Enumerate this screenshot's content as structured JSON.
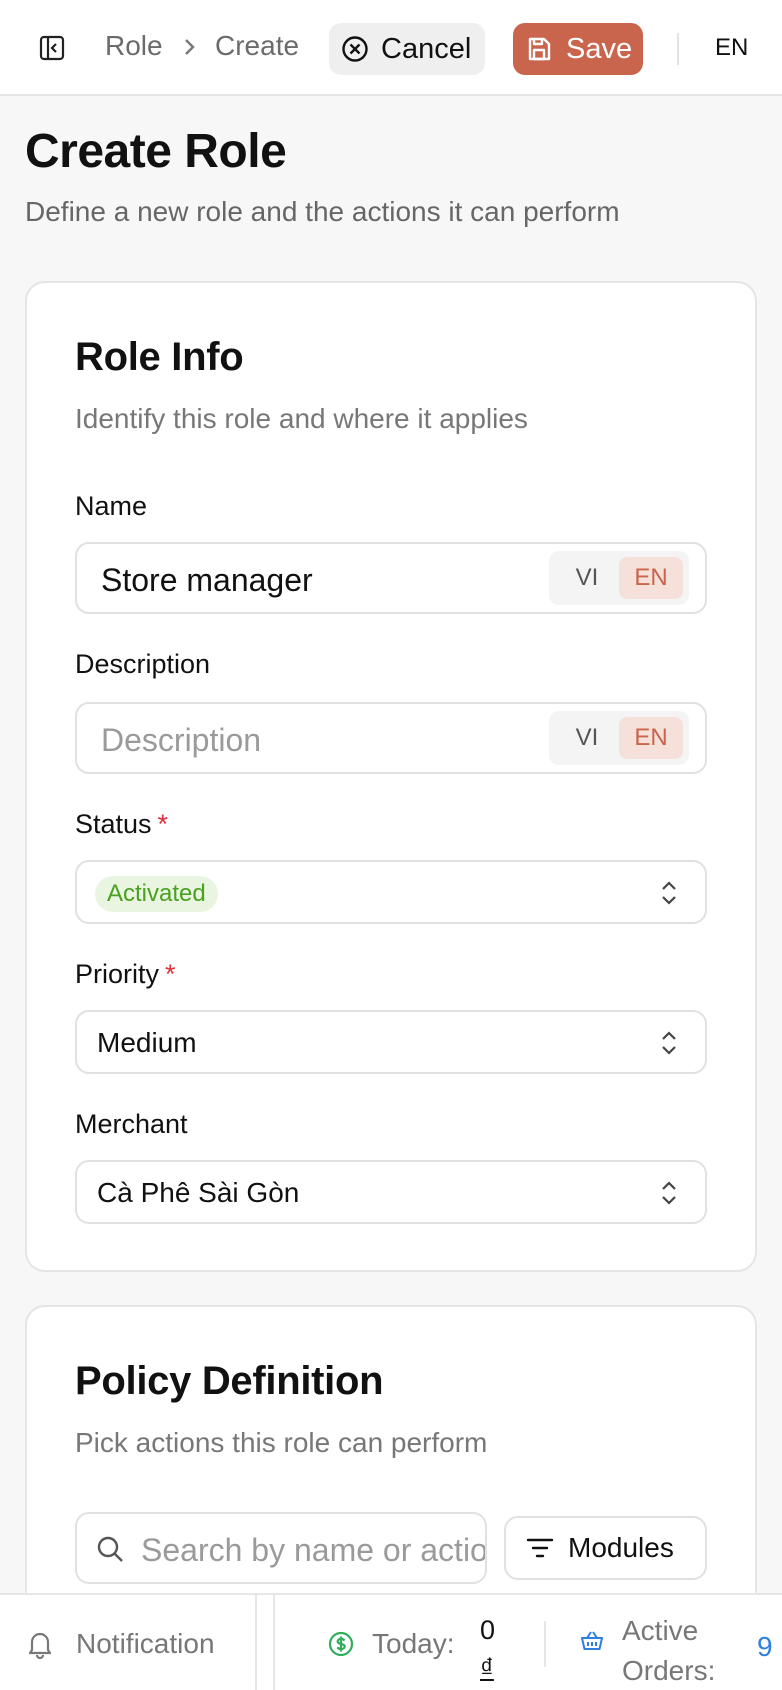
{
  "header": {
    "breadcrumb": [
      "Role",
      "Create"
    ],
    "cancel_label": "Cancel",
    "save_label": "Save",
    "language": "EN"
  },
  "page": {
    "title": "Create Role",
    "subtitle": "Define a new role and the actions it can perform"
  },
  "role_info": {
    "title": "Role Info",
    "subtitle": "Identify this role and where it applies",
    "name": {
      "label": "Name",
      "value": "Store manager",
      "lang_options": [
        "VI",
        "EN"
      ],
      "active_lang": "EN"
    },
    "description": {
      "label": "Description",
      "placeholder": "Description",
      "value": "",
      "lang_options": [
        "VI",
        "EN"
      ],
      "active_lang": "EN"
    },
    "status": {
      "label": "Status",
      "required_mark": "*",
      "value": "Activated",
      "badge_color": "#4aa01f"
    },
    "priority": {
      "label": "Priority",
      "required_mark": "*",
      "value": "Medium"
    },
    "merchant": {
      "label": "Merchant",
      "value": "Cà Phê Sài Gòn"
    }
  },
  "policy": {
    "title": "Policy Definition",
    "subtitle": "Pick actions this role can perform",
    "search_placeholder": "Search by name or action",
    "modules_label": "Modules"
  },
  "footer": {
    "notification_label": "Notification",
    "today_label": "Today:",
    "today_value": "0",
    "today_currency": "₫",
    "orders_label_line1": "Active",
    "orders_label_line2": "Orders:",
    "orders_value": "9"
  },
  "colors": {
    "accent": "#c9654c",
    "status_green": "#4aa01f",
    "link_blue": "#2d7fe0",
    "required_red": "#d9303c"
  },
  "icons": [
    "sidebar-toggle-icon",
    "chevron-right-icon",
    "close-circle-icon",
    "save-icon",
    "chevron-up-down-icon",
    "search-icon",
    "filter-icon",
    "bell-icon",
    "dollar-circle-icon",
    "basket-icon"
  ]
}
